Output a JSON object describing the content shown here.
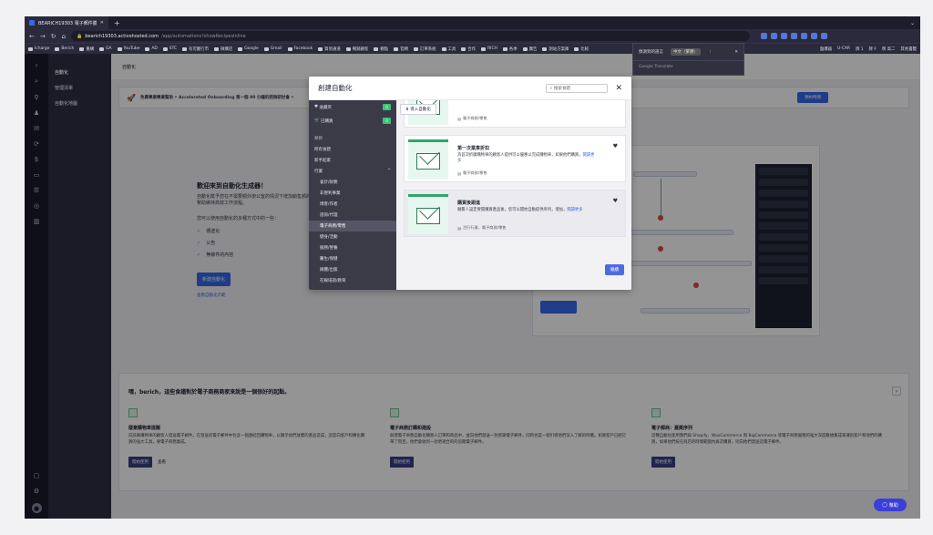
{
  "browser": {
    "tab_title": "BEARICH19303 電子郵件體驗",
    "url_host": "bearich19303.activehosted.com",
    "url_path": "/app/automations?showRecipesInline",
    "bookmarks": [
      "Icharge",
      "Berich",
      "重構",
      "GA",
      "YouTube",
      "AD",
      "STC",
      "有可翻行市",
      "微購店",
      "Google",
      "Gmail",
      "Facebook",
      "貿易通道",
      "暢銷顧客",
      "觀點",
      "官網",
      "訂單系統",
      "工具",
      "合作",
      "RICH",
      "各季",
      "廣告",
      "測站方案庫",
      "比較"
    ],
    "bookmarks_right": [
      "盤爆器",
      "U-CAR",
      "牌 1",
      "牌 F",
      "牌 高二",
      "其他書籤"
    ]
  },
  "translate_popup": {
    "lang_from": "偵測到的語言",
    "lang_to": "中文（繁體）",
    "footer": "Google Translate"
  },
  "sidenav": {
    "header": "自動化",
    "items": [
      "自動化",
      "管理清單",
      "自動化地圖"
    ]
  },
  "main": {
    "title": "自動化",
    "banner_text": "免費專業專業幫助 • Accelerated Onboarding 第一個 90 分鐘的諮詢研討會 •",
    "banner_button": "預約時間",
    "welcome_title": "歡迎來到自動化生成器！",
    "welcome_desc": "自動化賦予您在不需要額外辦公室的情況下增加銷售額的能力，幫助維持高效工作流程。",
    "welcome_sub": "您可以使用自動化的多種方式中的一些：",
    "checks": [
      "傳送化",
      "公告",
      "無條件的內容"
    ],
    "create_button": "新建自動化",
    "learn_link": "查看自動化示範"
  },
  "promo": {
    "heading": "嘿，berich，這些食譜對於電子商務商家來說是一個很好的起點。",
    "cards": [
      {
        "title": "廢棄購物車提醒",
        "desc": "向該廢購物車的顧客人發送電子郵件。在發送的電子郵件中包含一個連結回購物車，以顯示他們放棄的產品造成，這是向客戶和轉化購買的強大工具，要電子商務集成。",
        "btn": "開始使用",
        "btn2": "查看"
      },
      {
        "title": "電子商務訂購和建設",
        "desc": "創建電子商務自動化購買人訂單和商品中，並向他們發送一封感謝電子郵件，同時也是一個引導他們深入了解的時機。如果客戶已經訂單了而且，他們會收到一封更適合的的追蹤電子郵件。",
        "btn": "開始使用"
      },
      {
        "title": "電子郵商：嘉獎序列",
        "desc": "這種自動化使用我們與 Shopify、WooCommerce 和 BigCommerce 等電子商務服務的強大深度數據集成來識別客戶和他們的購買，如果他們按在商店的時間範圍內再次購買，則向他們發送這電子郵件。",
        "btn": "開始使用"
      }
    ]
  },
  "modal": {
    "title": "創建自動化",
    "search_placeholder": "搜索食譜",
    "import_label": "導入自動化",
    "sidebar": {
      "favorites": {
        "label": "收藏夾",
        "count": "0"
      },
      "purchased": {
        "label": "已購買",
        "count": "0"
      },
      "section_label": "類目",
      "all_recipes": "所有食譜",
      "getting_started": "新手起家",
      "industry_label": "行業",
      "industry_count": "^",
      "items": [
        "會計/財務",
        "非營利事業",
        "博客/作者",
        "諮詢/代理",
        "電子商務/零售",
        "健身/活動",
        "服務/營養",
        "醫生/保健",
        "媒體/出版",
        "在線培訓/教育"
      ]
    },
    "templates": [
      {
        "name": "",
        "desc": "",
        "more": "",
        "tags": "電子商務/零售"
      },
      {
        "name": "第一次業車折扣",
        "desc": "為首次折廣購物車的顧客人提供可以優惠以完成購物車，如果他們購買，",
        "more": "閱讀更多",
        "tags": "電子商務/零售"
      },
      {
        "name": "購買後跟進",
        "desc": "聯繫人設定要開購買產品後，您可以開始自動提供序列，增加，",
        "more": "閱讀更多",
        "tags": "活行行業，電子商務/零售"
      }
    ],
    "continue_button": "繼續"
  },
  "help_button": "幫助"
}
